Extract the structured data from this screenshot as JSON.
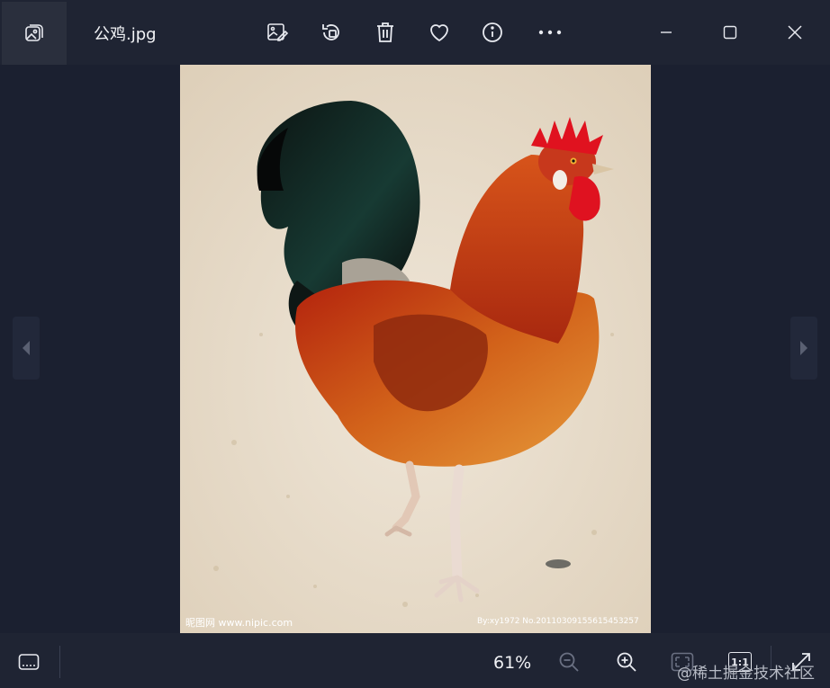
{
  "window": {
    "title": "公鸡.jpg"
  },
  "toolbar": {
    "icons": [
      "gallery-icon",
      "edit-image-icon",
      "rotate-icon",
      "delete-icon",
      "favorite-icon",
      "info-icon",
      "more-icon"
    ]
  },
  "window_controls": [
    "minimize-icon",
    "maximize-icon",
    "close-icon"
  ],
  "image": {
    "watermark_left": "昵图网 www.nipic.com",
    "watermark_right": "By:xy1972 No.20110309155615453257"
  },
  "bottom": {
    "zoom_level": "61%",
    "actual_size_label": "1:1",
    "site_watermark": "@稀土掘金技术社区"
  },
  "colors": {
    "background": "#1c2130",
    "accent": "#e8eaf0"
  }
}
